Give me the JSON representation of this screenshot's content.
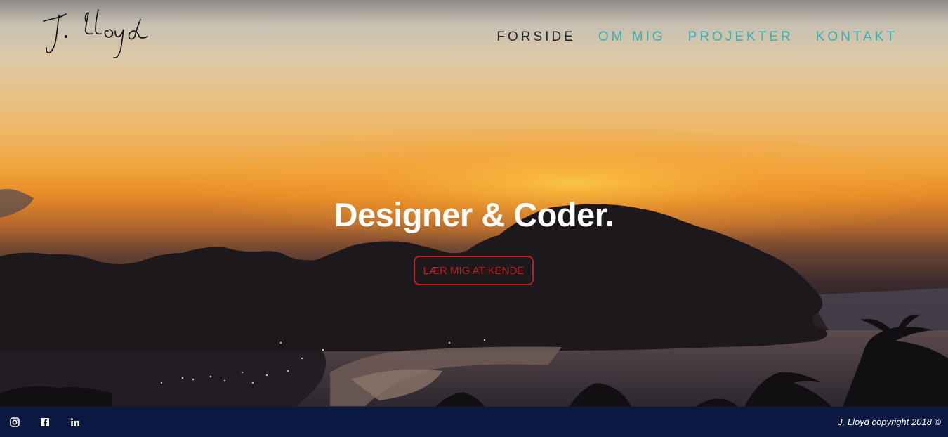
{
  "header": {
    "logo_text": "J. Lloyd"
  },
  "nav": {
    "items": [
      {
        "label": "FORSIDE",
        "active": true
      },
      {
        "label": "OM MIG",
        "active": false
      },
      {
        "label": "PROJEKTER",
        "active": false
      },
      {
        "label": "KONTAKT",
        "active": false
      }
    ]
  },
  "hero": {
    "headline": "Designer & Coder.",
    "cta_label": "LÆR MIG AT KENDE"
  },
  "footer": {
    "social": [
      {
        "icon": "instagram-icon"
      },
      {
        "icon": "facebook-icon"
      },
      {
        "icon": "linkedin-icon"
      }
    ],
    "copyright": "J. Lloyd copyright 2018 ©"
  },
  "colors": {
    "accent": "#3ab0b2",
    "nav_active": "#1f2a2e",
    "cta": "#b7221f",
    "footer_bg": "#0b1840"
  }
}
